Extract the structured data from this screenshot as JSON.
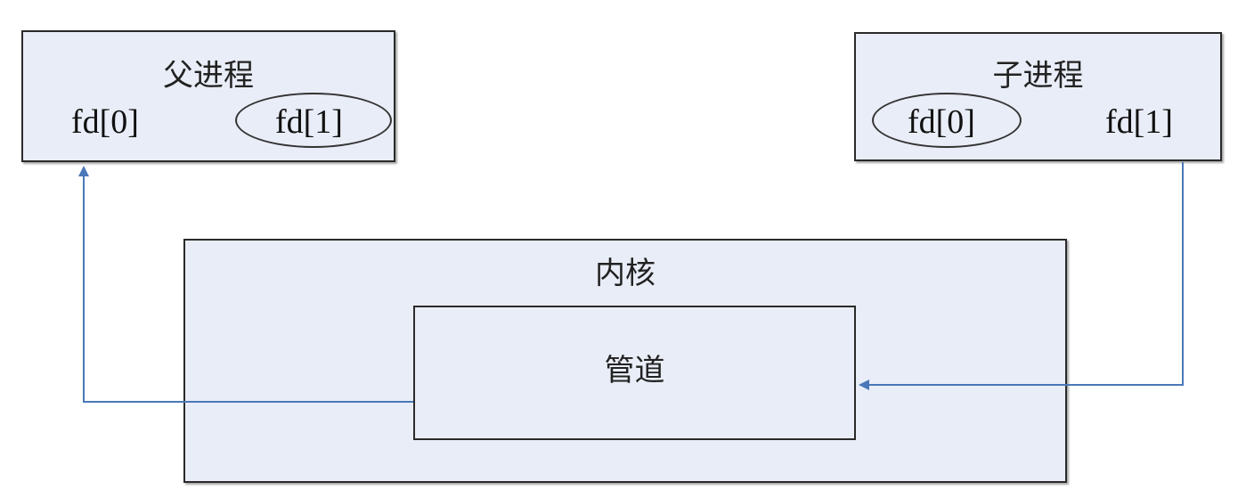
{
  "parent_process": {
    "title": "父进程",
    "fd_read": "fd[0]",
    "fd_write": "fd[1]",
    "circled": "fd[1]"
  },
  "child_process": {
    "title": "子进程",
    "fd_read": "fd[0]",
    "fd_write": "fd[1]",
    "circled": "fd[0]"
  },
  "kernel": {
    "title": "内核",
    "pipe": {
      "title": "管道"
    }
  },
  "colors": {
    "box_fill": "#e9edf7",
    "box_border": "#2a2a2a",
    "arrow": "#4a78b8"
  },
  "flows": [
    {
      "from": "child_process.fd[1]",
      "to": "kernel.pipe"
    },
    {
      "from": "kernel.pipe",
      "to": "parent_process.fd[0]"
    }
  ]
}
